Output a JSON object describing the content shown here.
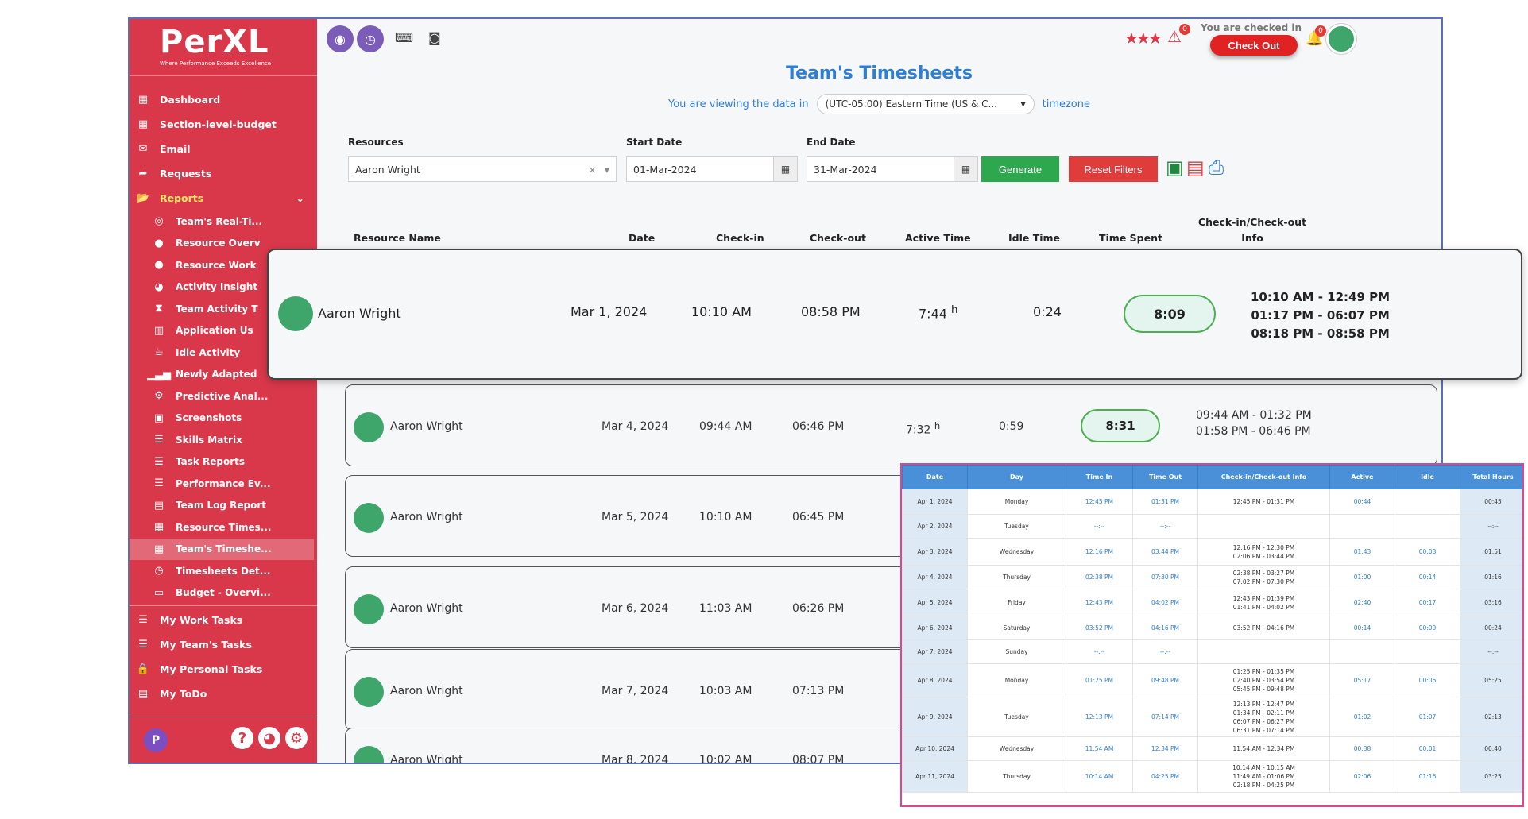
{
  "brand": {
    "name": "PerXL",
    "tagline": "Where Performance Exceeds Excellence"
  },
  "sidebar": {
    "items": [
      {
        "label": "Dashboard",
        "icon": "grid-icon"
      },
      {
        "label": "Section-level-budget",
        "icon": "grid-icon"
      },
      {
        "label": "Email",
        "icon": "mail-icon"
      },
      {
        "label": "Requests",
        "icon": "share-icon"
      },
      {
        "label": "Reports",
        "icon": "folder-icon"
      }
    ],
    "reports_sub": [
      "Team's Real-Ti...",
      "Resource Overv",
      "Resource Work",
      "Activity Insight",
      "Team Activity T",
      "Application Us",
      "Idle Activity",
      "Newly Adapted",
      "Predictive Anal...",
      "Screenshots",
      "Skills Matrix",
      "Task Reports",
      "Performance Ev...",
      "Team Log Report",
      "Resource Times...",
      "Team's Timeshe...",
      "Timesheets Det...",
      "Budget - Overvi..."
    ],
    "bottom_items": [
      "My Work Tasks",
      "My Team's Tasks",
      "My Personal Tasks",
      "My ToDo"
    ],
    "avatar_letter": "P"
  },
  "topbar": {
    "checked_text": "You are checked in",
    "checkout_label": "Check Out",
    "badge_warn": "0",
    "badge_bell": "0"
  },
  "page": {
    "title": "Team's Timesheets",
    "tz_prefix": "You are viewing the data in",
    "tz_value": "(UTC-05:00) Eastern Time (US & C...",
    "tz_suffix": "timezone"
  },
  "filters": {
    "resources_label": "Resources",
    "resources_value": "Aaron Wright",
    "start_label": "Start Date",
    "start_value": "01-Mar-2024",
    "end_label": "End Date",
    "end_value": "31-Mar-2024",
    "generate_label": "Generate",
    "reset_label": "Reset Filters"
  },
  "table": {
    "headers": [
      "Resource Name",
      "Date",
      "Check-in",
      "Check-out",
      "Active Time",
      "Idle Time",
      "Time Spent",
      "Check-in/Check-out",
      "Info"
    ],
    "hours_suffix": "h",
    "featured": {
      "name": "Aaron Wright",
      "date": "Mar 1, 2024",
      "cin": "10:10 AM",
      "cout": "08:58 PM",
      "active": "7:44",
      "idle": "0:24",
      "spent": "8:09",
      "info": [
        "10:10 AM - 12:49 PM",
        "01:17 PM - 06:07 PM",
        "08:18 PM - 08:58 PM"
      ]
    },
    "rows": [
      {
        "name": "Aaron Wright",
        "date": "Mar 4, 2024",
        "cin": "09:44 AM",
        "cout": "06:46 PM",
        "active": "7:32",
        "idle": "0:59",
        "spent": "8:31",
        "info1": "09:44 AM - 01:32 PM",
        "info2": "01:58 PM - 06:46 PM"
      },
      {
        "name": "Aaron Wright",
        "date": "Mar 5, 2024",
        "cin": "10:10 AM",
        "cout": "06:45 PM"
      },
      {
        "name": "Aaron Wright",
        "date": "Mar 6, 2024",
        "cin": "11:03 AM",
        "cout": "06:26 PM"
      },
      {
        "name": "Aaron Wright",
        "date": "Mar 7, 2024",
        "cin": "10:03 AM",
        "cout": "07:13 PM"
      },
      {
        "name": "Aaron Wright",
        "date": "Mar 8, 2024",
        "cin": "10:02 AM",
        "cout": "08:07 PM"
      }
    ]
  },
  "detail": {
    "headers": [
      "Date",
      "Day",
      "Time In",
      "Time Out",
      "Check-in/Check-out Info",
      "Active",
      "Idle",
      "Total Hours"
    ],
    "rows": [
      {
        "date": "Apr 1, 2024",
        "day": "Monday",
        "tin": "12:45 PM",
        "tout": "01:31 PM",
        "info": "12:45 PM - 01:31 PM",
        "active": "00:44",
        "idle": "",
        "total": "00:45"
      },
      {
        "date": "Apr 2, 2024",
        "day": "Tuesday",
        "tin": "--:--",
        "tout": "--:--",
        "info": "",
        "active": "",
        "idle": "",
        "total": "--:--"
      },
      {
        "date": "Apr 3, 2024",
        "day": "Wednesday",
        "tin": "12:16 PM",
        "tout": "03:44 PM",
        "info": "12:16 PM - 12:30 PM\n02:06 PM - 03:44 PM",
        "active": "01:43",
        "idle": "00:08",
        "total": "01:51"
      },
      {
        "date": "Apr 4, 2024",
        "day": "Thursday",
        "tin": "02:38 PM",
        "tout": "07:30 PM",
        "info": "02:38 PM - 03:27 PM\n07:02 PM - 07:30 PM",
        "active": "01:00",
        "idle": "00:14",
        "total": "01:16"
      },
      {
        "date": "Apr 5, 2024",
        "day": "Friday",
        "tin": "12:43 PM",
        "tout": "04:02 PM",
        "info": "12:43 PM - 01:39 PM\n01:41 PM - 04:02 PM",
        "active": "02:40",
        "idle": "00:17",
        "total": "03:16"
      },
      {
        "date": "Apr 6, 2024",
        "day": "Saturday",
        "tin": "03:52 PM",
        "tout": "04:16 PM",
        "info": "03:52 PM - 04:16 PM",
        "active": "00:14",
        "idle": "00:09",
        "total": "00:24"
      },
      {
        "date": "Apr 7, 2024",
        "day": "Sunday",
        "tin": "--:--",
        "tout": "--:--",
        "info": "",
        "active": "",
        "idle": "",
        "total": "--:--"
      },
      {
        "date": "Apr 8, 2024",
        "day": "Monday",
        "tin": "01:25 PM",
        "tout": "09:48 PM",
        "info": "01:25 PM - 01:35 PM\n02:40 PM - 03:54 PM\n05:45 PM - 09:48 PM",
        "active": "05:17",
        "idle": "00:06",
        "total": "05:25"
      },
      {
        "date": "Apr 9, 2024",
        "day": "Tuesday",
        "tin": "12:13 PM",
        "tout": "07:14 PM",
        "info": "12:13 PM - 12:47 PM\n01:34 PM - 02:11 PM\n06:07 PM - 06:27 PM\n06:31 PM - 07:14 PM",
        "active": "01:02",
        "idle": "01:07",
        "total": "02:13"
      },
      {
        "date": "Apr 10, 2024",
        "day": "Wednesday",
        "tin": "11:54 AM",
        "tout": "12:34 PM",
        "info": "11:54 AM - 12:34 PM",
        "active": "00:38",
        "idle": "00:01",
        "total": "00:40"
      },
      {
        "date": "Apr 11, 2024",
        "day": "Thursday",
        "tin": "10:14 AM",
        "tout": "04:25 PM",
        "info": "10:14 AM - 10:15 AM\n11:49 AM - 01:06 PM\n02:18 PM - 04:25 PM",
        "active": "02:06",
        "idle": "01:16",
        "total": "03:25"
      }
    ]
  }
}
